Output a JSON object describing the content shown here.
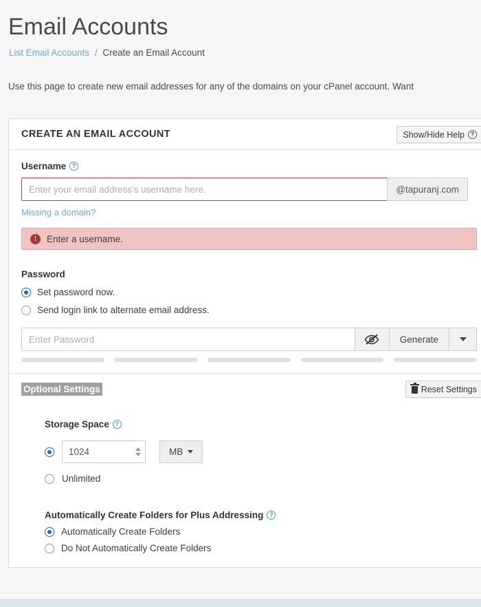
{
  "header": {
    "title": "Email Accounts",
    "breadcrumb": {
      "link_label": "List Email Accounts",
      "separator": "/",
      "current": "Create an Email Account"
    },
    "intro": "Use this page to create new email addresses for any of the domains on your cPanel account. Want"
  },
  "card": {
    "title": "CREATE AN EMAIL ACCOUNT",
    "help_button": "Show/Hide Help",
    "help_icon": "question-circle-icon"
  },
  "username": {
    "label": "Username",
    "help_icon": "question-circle-icon",
    "placeholder": "Enter your email address's username here.",
    "value": "",
    "domain": "@tapuranj.com",
    "missing_domain_link": "Missing a domain?",
    "error": {
      "icon": "exclamation-circle-icon",
      "message": "Enter a username."
    }
  },
  "password": {
    "label": "Password",
    "options": [
      {
        "label": "Set password now.",
        "selected": true
      },
      {
        "label": "Send login link to alternate email address.",
        "selected": false
      }
    ],
    "placeholder": "Enter Password",
    "value": "",
    "toggle_icon": "eye-slash-icon",
    "generate_label": "Generate",
    "caret_icon": "chevron-down-icon",
    "strength_segments": 5
  },
  "optional_settings": {
    "title": "Optional Settings",
    "reset_button": "Reset Settings",
    "reset_icon": "trash-icon",
    "storage": {
      "label": "Storage Space",
      "help_icon": "question-circle-icon",
      "value": "1024",
      "unit": "MB",
      "unit_caret_icon": "chevron-down-icon",
      "limited_selected": true,
      "unlimited_label": "Unlimited",
      "unlimited_selected": false
    },
    "plus_addressing": {
      "label": "Automatically Create Folders for Plus Addressing",
      "help_icon": "question-circle-icon",
      "options": [
        {
          "label": "Automatically Create Folders",
          "selected": true
        },
        {
          "label": "Do Not Automatically Create Folders",
          "selected": false
        }
      ]
    }
  },
  "colors": {
    "link": "#72a9cd",
    "accent": "#1b6ec2",
    "error_border": "#a94442",
    "error_bg": "#f2c3c3",
    "page_bg": "#f6f6f6"
  }
}
